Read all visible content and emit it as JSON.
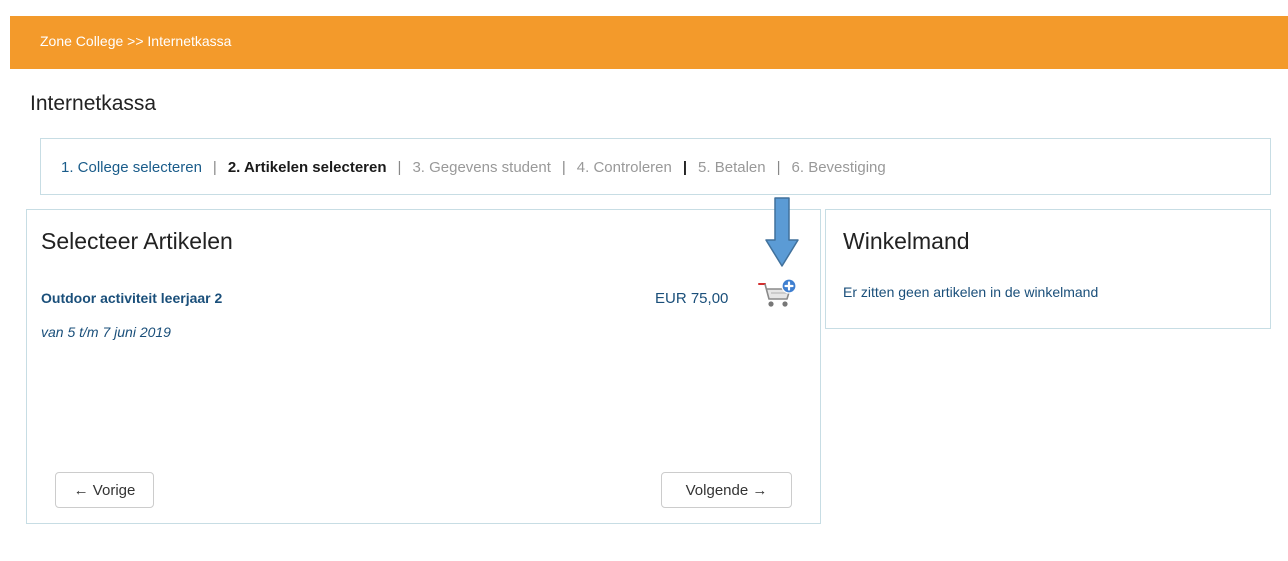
{
  "header": {
    "breadcrumb": "Zone College >> Internetkassa",
    "bar_color": "#f39a2b"
  },
  "page": {
    "title": "Internetkassa"
  },
  "steps": [
    {
      "label": "1. College selecteren",
      "state": "done"
    },
    {
      "label": "2. Artikelen selecteren",
      "state": "active"
    },
    {
      "label": "3. Gegevens student",
      "state": "pending"
    },
    {
      "label": "4. Controleren",
      "state": "pending"
    },
    {
      "label": "5. Betalen",
      "state": "pending"
    },
    {
      "label": "6. Bevestiging",
      "state": "pending"
    }
  ],
  "articles_panel": {
    "title": "Selecteer Artikelen",
    "item": {
      "name": "Outdoor activiteit leerjaar 2",
      "date": "van 5 t/m 7 juni 2019",
      "price": "EUR 75,00",
      "add_icon": "cart-add-icon"
    },
    "prev_button": "← Vorige",
    "next_button": "Volgende →"
  },
  "cart_panel": {
    "title": "Winkelmand",
    "empty_message": "Er zitten geen artikelen in de winkelmand"
  },
  "annotation": {
    "icon": "arrow-down-icon",
    "color": "#5b9bd5"
  }
}
